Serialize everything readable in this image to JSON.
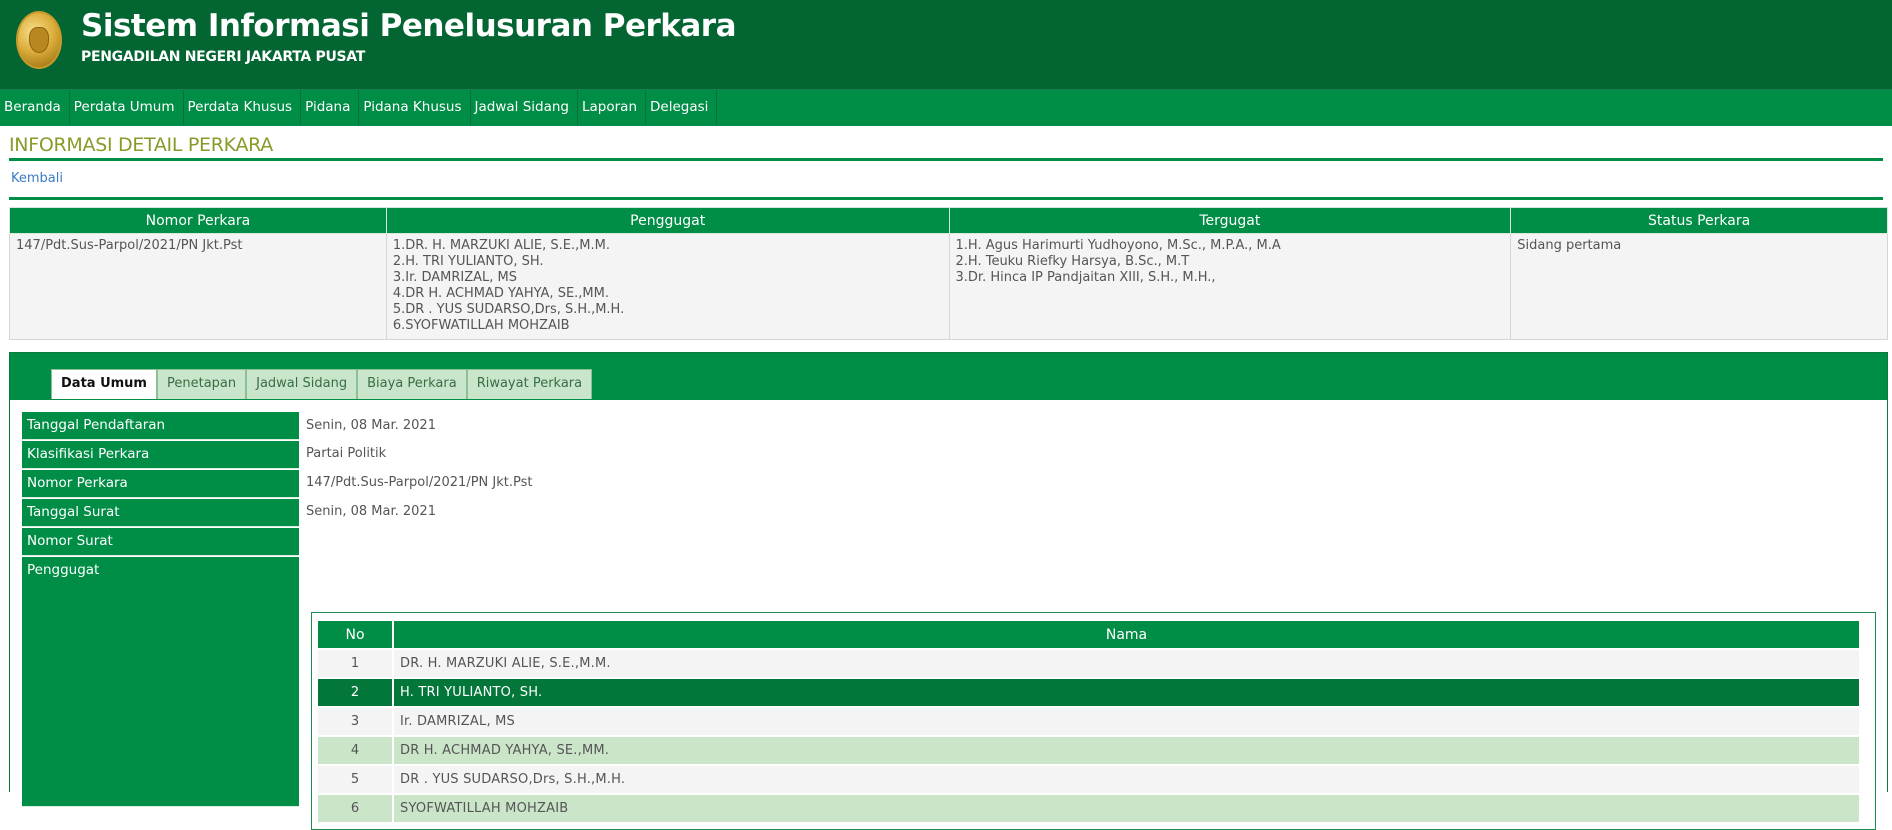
{
  "header": {
    "title": "Sistem Informasi Penelusuran Perkara",
    "subtitle": "PENGADILAN NEGERI JAKARTA PUSAT",
    "logo": "court-seal-emblem",
    "colors": {
      "brand": "#036632",
      "accent": "#008d46",
      "title_text": "#8a9a2a"
    }
  },
  "nav": {
    "items": [
      "Beranda",
      "Perdata Umum",
      "Perdata Khusus",
      "Pidana",
      "Pidana Khusus",
      "Jadwal Sidang",
      "Laporan",
      "Delegasi"
    ]
  },
  "page": {
    "title": "INFORMASI DETAIL PERKARA",
    "back_link": "Kembali"
  },
  "summary": {
    "headers": [
      "Nomor Perkara",
      "Penggugat",
      "Tergugat",
      "Status Perkara"
    ],
    "nomor_perkara": "147/Pdt.Sus-Parpol/2021/PN Jkt.Pst",
    "penggugat": [
      "1.DR. H. MARZUKI ALIE, S.E.,M.M.",
      "2.H. TRI YULIANTO, SH.",
      "3.Ir. DAMRIZAL, MS",
      "4.DR H. ACHMAD YAHYA, SE.,MM.",
      "5.DR . YUS SUDARSO,Drs, S.H.,M.H.",
      "6.SYOFWATILLAH MOHZAIB"
    ],
    "tergugat": [
      "1.H. Agus Harimurti Yudhoyono, M.Sc., M.P.A., M.A",
      "2.H. Teuku Riefky Harsya, B.Sc., M.T",
      "3.Dr. Hinca IP Pandjaitan XIII, S.H., M.H.,"
    ],
    "status": "Sidang pertama"
  },
  "tabs": [
    {
      "label": "Data Umum",
      "active": true
    },
    {
      "label": "Penetapan",
      "active": false
    },
    {
      "label": "Jadwal Sidang",
      "active": false
    },
    {
      "label": "Biaya Perkara",
      "active": false
    },
    {
      "label": "Riwayat Perkara",
      "active": false
    }
  ],
  "data_umum": {
    "rows": [
      {
        "label": "Tanggal Pendaftaran",
        "value": "Senin, 08 Mar. 2021"
      },
      {
        "label": "Klasifikasi Perkara",
        "value": "Partai Politik"
      },
      {
        "label": "Nomor Perkara",
        "value": "147/Pdt.Sus-Parpol/2021/PN Jkt.Pst"
      },
      {
        "label": "Tanggal Surat",
        "value": "Senin, 08 Mar. 2021"
      },
      {
        "label": "Nomor Surat",
        "value": ""
      },
      {
        "label": "Penggugat",
        "value": ""
      }
    ]
  },
  "penggugat_table": {
    "headers": [
      "No",
      "Nama"
    ],
    "rows": [
      {
        "no": "1",
        "nama": "DR. H. MARZUKI ALIE, S.E.,M.M."
      },
      {
        "no": "2",
        "nama": "H. TRI YULIANTO, SH."
      },
      {
        "no": "3",
        "nama": "Ir. DAMRIZAL, MS"
      },
      {
        "no": "4",
        "nama": "DR H. ACHMAD YAHYA, SE.,MM."
      },
      {
        "no": "5",
        "nama": "DR . YUS SUDARSO,Drs, S.H.,M.H."
      },
      {
        "no": "6",
        "nama": "SYOFWATILLAH MOHZAIB"
      }
    ]
  }
}
